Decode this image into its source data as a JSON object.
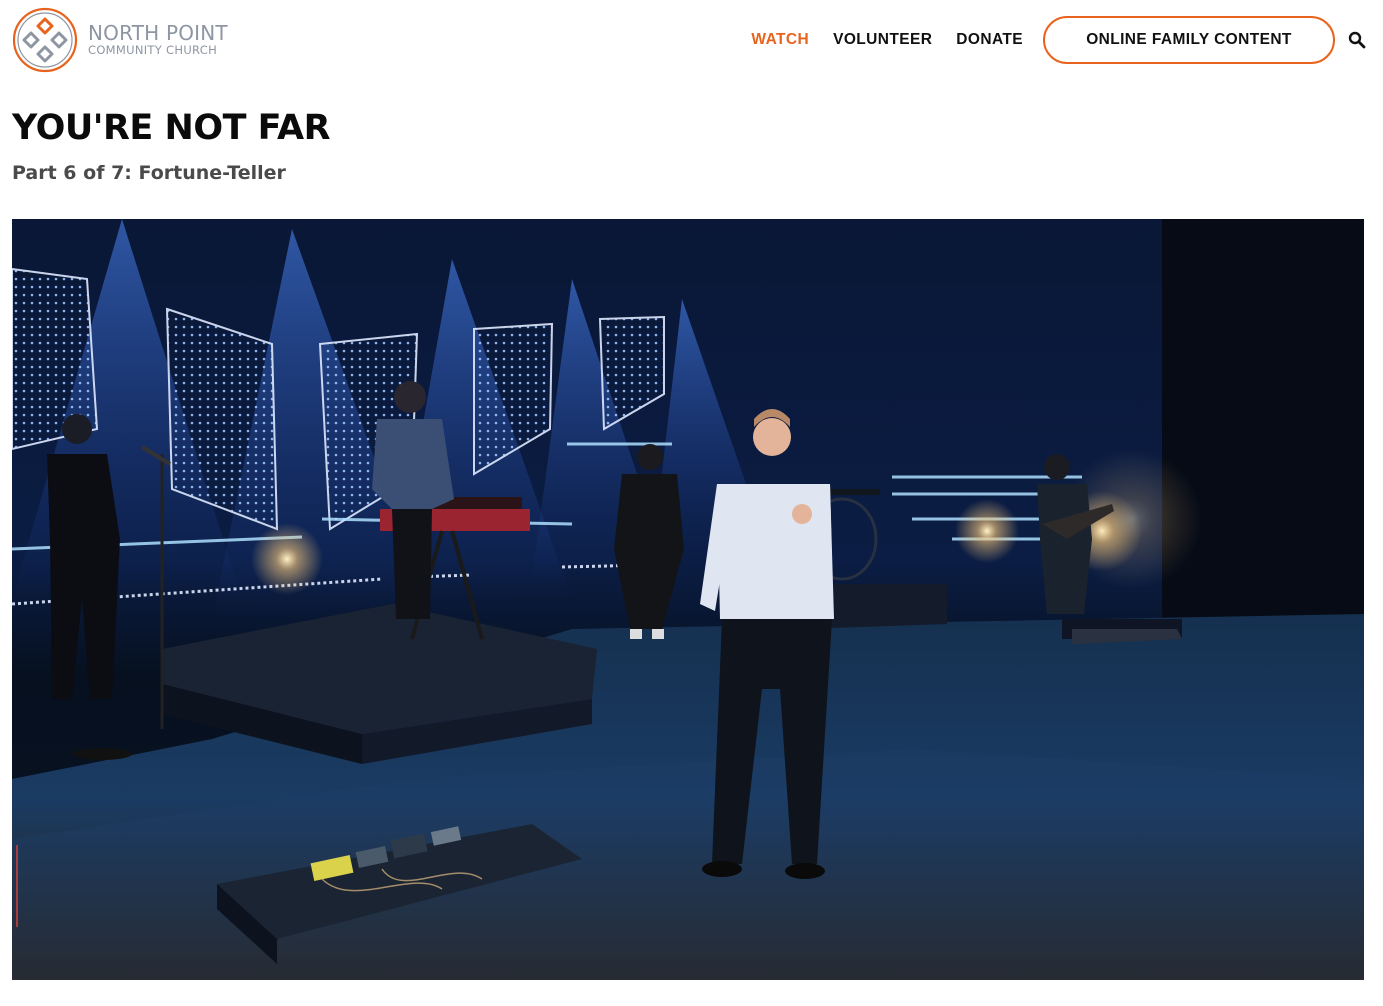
{
  "logo": {
    "name": "NORTH POINT",
    "sub": "COMMUNITY CHURCH",
    "icon": "north-point-logo",
    "color": "#e8641e"
  },
  "nav": {
    "items": [
      "WATCH",
      "VOLUNTEER",
      "DONATE"
    ],
    "active": "WATCH",
    "cta": "ONLINE FAMILY CONTENT",
    "search_icon": "search-icon"
  },
  "page": {
    "title": "YOU'RE NOT FAR",
    "subtitle": "Part 6 of 7: Fortune-Teller"
  },
  "video": {
    "icon": "video-player",
    "scene": "stage-with-speaker-and-band"
  },
  "colors": {
    "accent": "#e8641e",
    "text": "#111111",
    "subtitle": "#4a4a4a"
  }
}
